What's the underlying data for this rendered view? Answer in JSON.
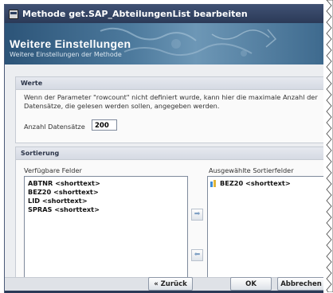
{
  "window": {
    "title": "Methode get.SAP_AbteilungenList bearbeiten"
  },
  "banner": {
    "title": "Weitere Einstellungen",
    "subtitle": "Weitere Einstellungen der Methode"
  },
  "werte": {
    "heading": "Werte",
    "description_line1": "Wenn der Parameter \"rowcount\" nicht definiert wurde, kann hier die maximale Anzahl der",
    "description_line2": "Datensätze, die gelesen werden sollen, angegeben werden.",
    "count_label": "Anzahl Datensätze",
    "count_value": "200"
  },
  "sortierung": {
    "heading": "Sortierung",
    "available_label": "Verfügbare Felder",
    "available_items": [
      "ABTNR <shorttext>",
      "BEZ20 <shorttext>",
      "LID <shorttext>",
      "SPRAS <shorttext>"
    ],
    "selected_label": "Ausgewählte Sortierfelder",
    "selected_items": [
      "BEZ20 <shorttext>"
    ],
    "move_right_icon": "arrow-right-icon",
    "move_left_icon": "arrow-left-icon"
  },
  "buttons": {
    "back": "« Zurück",
    "ok": "OK",
    "cancel": "Abbrechen"
  },
  "colors": {
    "titlebar": "#2b3a57",
    "banner": "#4d7a9d",
    "accent": "#3d8bd6"
  }
}
